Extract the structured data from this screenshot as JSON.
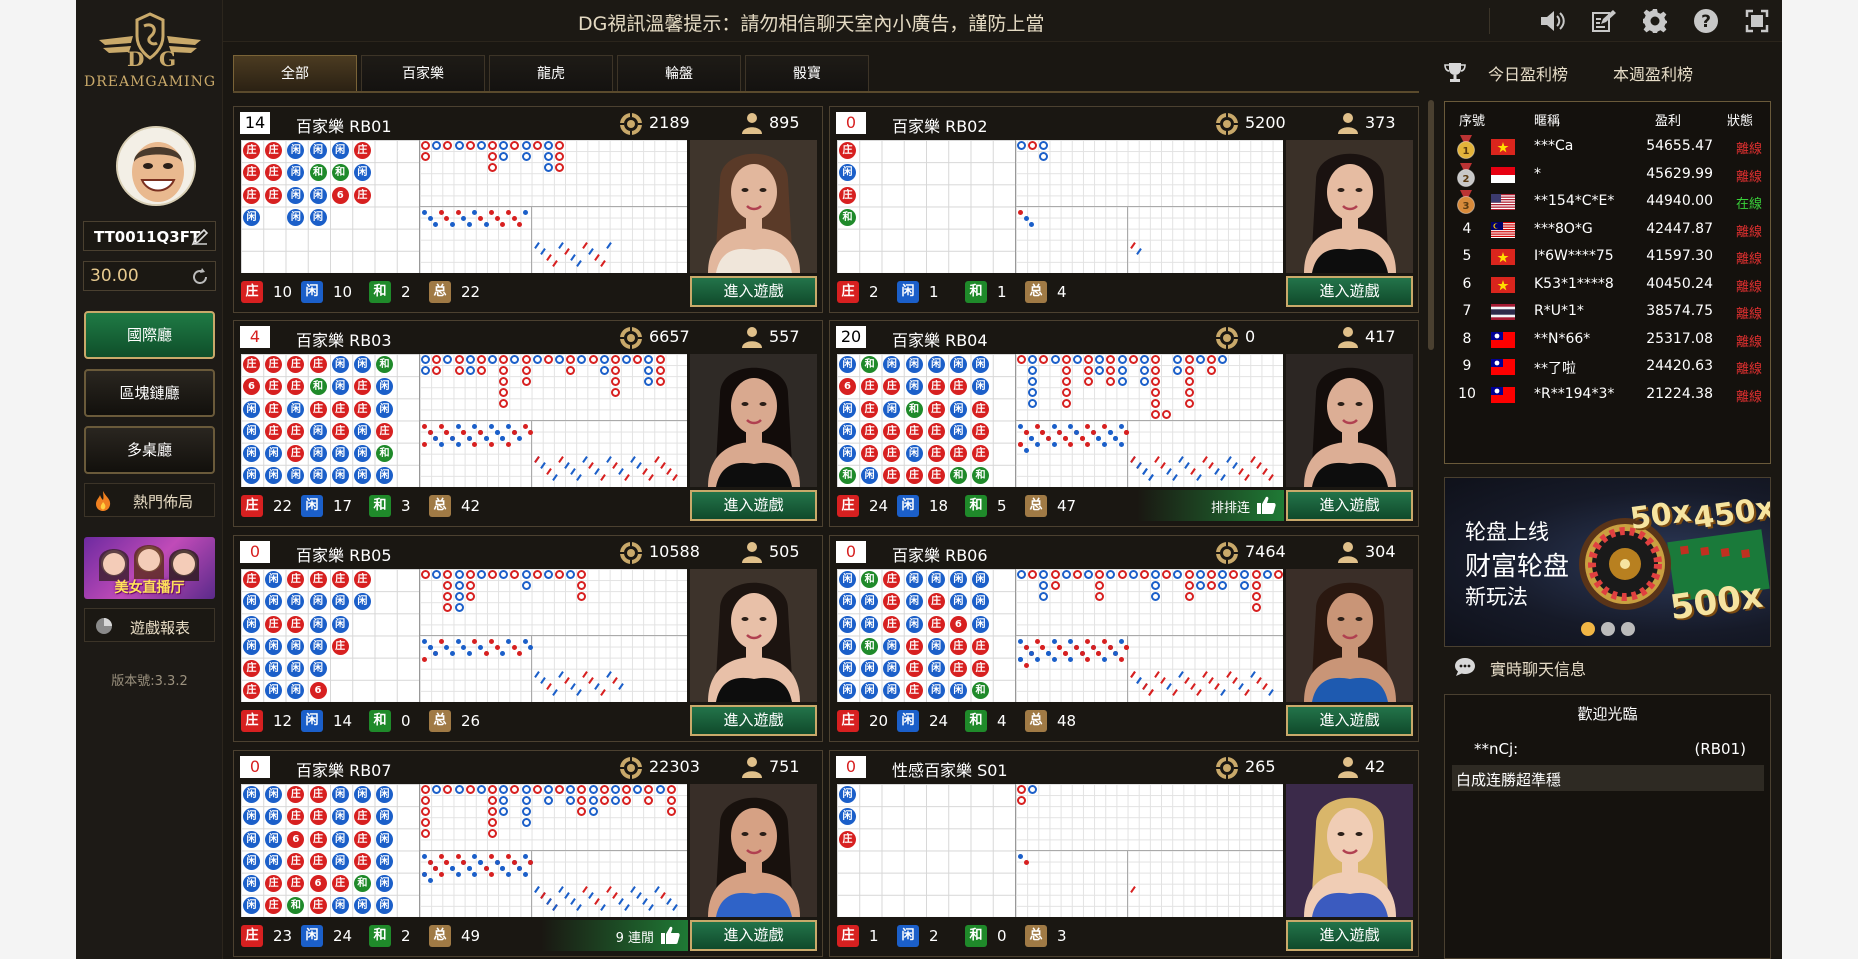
{
  "brand": {
    "name": "DREAMGAMING"
  },
  "notice": "DG視訊溫馨提示：請勿相信聊天室內小廣告，謹防上當",
  "user": {
    "account": "TT0011Q3FT",
    "balance": "30.00"
  },
  "sidebar": {
    "halls": [
      "國際廳",
      "區塊鏈廳",
      "多桌廳"
    ],
    "active_hall": 0,
    "hot_label": "熱門佈局",
    "banner_text": "美女直播厅",
    "report_label": "遊戲報表",
    "version": "版本號:3.3.2"
  },
  "tabs": [
    "全部",
    "百家樂",
    "龍虎",
    "輪盤",
    "骰寶"
  ],
  "active_tab": 0,
  "enter_label": "進入遊戲",
  "stat_badges": {
    "banker": "庄",
    "player": "闲",
    "tie": "和",
    "total": "总"
  },
  "tables": [
    {
      "id": "14",
      "id_color": "#000000",
      "name": "百家樂 RB01",
      "chips": "2189",
      "online": "895",
      "b": "10",
      "p": "10",
      "t": "2",
      "total": "22",
      "streak": "",
      "beads": [
        "BBBP",
        "BBB",
        "PPPP",
        "PTPP",
        "PT6",
        "BPB"
      ]
    },
    {
      "id": "0",
      "id_color": "#d72020",
      "name": "百家樂 RB02",
      "chips": "5200",
      "online": "373",
      "b": "2",
      "p": "1",
      "t": "1",
      "total": "4",
      "streak": "",
      "beads": [
        "BPBT"
      ]
    },
    {
      "id": "4",
      "id_color": "#d72020",
      "name": "百家樂 RB03",
      "chips": "6657",
      "online": "557",
      "b": "22",
      "p": "17",
      "t": "3",
      "total": "42",
      "streak": "",
      "beads": [
        "B6PPPP",
        "BBBBPP",
        "BBPBBP",
        "BTBPPP",
        "PPBBPP",
        "PBBPPP",
        "TPPBTP"
      ]
    },
    {
      "id": "20",
      "id_color": "#000000",
      "name": "百家樂 RB04",
      "chips": "0",
      "online": "417",
      "b": "24",
      "p": "18",
      "t": "5",
      "total": "47",
      "streak": "排排连",
      "beads": [
        "P6PPPT6",
        "TBBBBPT",
        "PBPBBBP",
        "PPTBPBP",
        "PBBBBBP",
        "PBPPBTP",
        "PPBBBTP"
      ]
    },
    {
      "id": "0",
      "id_color": "#d72020",
      "name": "百家樂 RB05",
      "chips": "10588",
      "online": "505",
      "b": "12",
      "p": "14",
      "t": "0",
      "total": "26",
      "streak": "",
      "beads": [
        "BPPPBB",
        "PPBPPP",
        "BPBPPP",
        "BPPPP6",
        "BPPB",
        "BP"
      ]
    },
    {
      "id": "0",
      "id_color": "#d72020",
      "name": "百家樂 RB06",
      "chips": "7464",
      "online": "304",
      "b": "20",
      "p": "24",
      "t": "4",
      "total": "48",
      "streak": "",
      "beads": [
        "PPPPPPP",
        "TPPTPPP",
        "BBBPPPB",
        "PPPBBBB",
        "PBBPPPB",
        "PP6BBPP",
        "PPPBBTB"
      ]
    },
    {
      "id": "0",
      "id_color": "#d72020",
      "name": "百家樂 RB07",
      "chips": "22303",
      "online": "751",
      "b": "23",
      "p": "24",
      "t": "2",
      "total": "49",
      "streak": "9 連閒",
      "beads": [
        "PPPPPPP",
        "PPPPBBP",
        "BB6BBTB",
        "BBBB6BB",
        "PPPPBPP",
        "PBBBTPP",
        "PPPPPP"
      ]
    },
    {
      "id": "0",
      "id_color": "#d72020",
      "name": "性感百家樂 S01",
      "chips": "265",
      "online": "42",
      "b": "1",
      "p": "2",
      "t": "0",
      "total": "3",
      "streak": "",
      "beads": [
        "PPB"
      ]
    }
  ],
  "ranking": {
    "tabs": [
      "今日盈利榜",
      "本週盈利榜"
    ],
    "columns": [
      "序號",
      "暱稱",
      "盈利",
      "狀態"
    ],
    "rows": [
      {
        "no": "1",
        "flag": "vn",
        "nick": "***Ca",
        "amount": "54655.47",
        "status": "離線"
      },
      {
        "no": "2",
        "flag": "id",
        "nick": "*",
        "amount": "45629.99",
        "status": "離線"
      },
      {
        "no": "3",
        "flag": "us",
        "nick": "**154*C*E*",
        "amount": "44940.00",
        "status": "在線"
      },
      {
        "no": "4",
        "flag": "my",
        "nick": "***8O*G",
        "amount": "42447.87",
        "status": "離線"
      },
      {
        "no": "5",
        "flag": "vn",
        "nick": "I*6W****75",
        "amount": "41597.30",
        "status": "離線"
      },
      {
        "no": "6",
        "flag": "vn",
        "nick": "K53*1****8",
        "amount": "40450.24",
        "status": "離線"
      },
      {
        "no": "7",
        "flag": "th",
        "nick": "R*U*1*",
        "amount": "38574.75",
        "status": "離線"
      },
      {
        "no": "8",
        "flag": "tw",
        "nick": "**N*66*",
        "amount": "25317.08",
        "status": "離線"
      },
      {
        "no": "9",
        "flag": "tw",
        "nick": "**了啦",
        "amount": "24420.63",
        "status": "離線"
      },
      {
        "no": "10",
        "flag": "tw",
        "nick": "*R**194*3*",
        "amount": "21224.38",
        "status": "離線"
      }
    ]
  },
  "promo": {
    "line1": "轮盘上线",
    "line2": "财富轮盘",
    "line3": "新玩法",
    "m1": "50x",
    "m2": "450x",
    "m3": "500x",
    "slides": 3,
    "active_slide": 0
  },
  "chat": {
    "title": "實時聊天信息",
    "welcome": "歡迎光臨",
    "user": "**nCj:",
    "room": "(RB01)",
    "message": "白成连勝超準穩"
  },
  "colors": {
    "gold": "#c9a96a",
    "banker": "#d72020",
    "player": "#1b5fc9",
    "tie": "#1f8a2a",
    "online": "#3ad13a",
    "offline": "#e03030"
  }
}
